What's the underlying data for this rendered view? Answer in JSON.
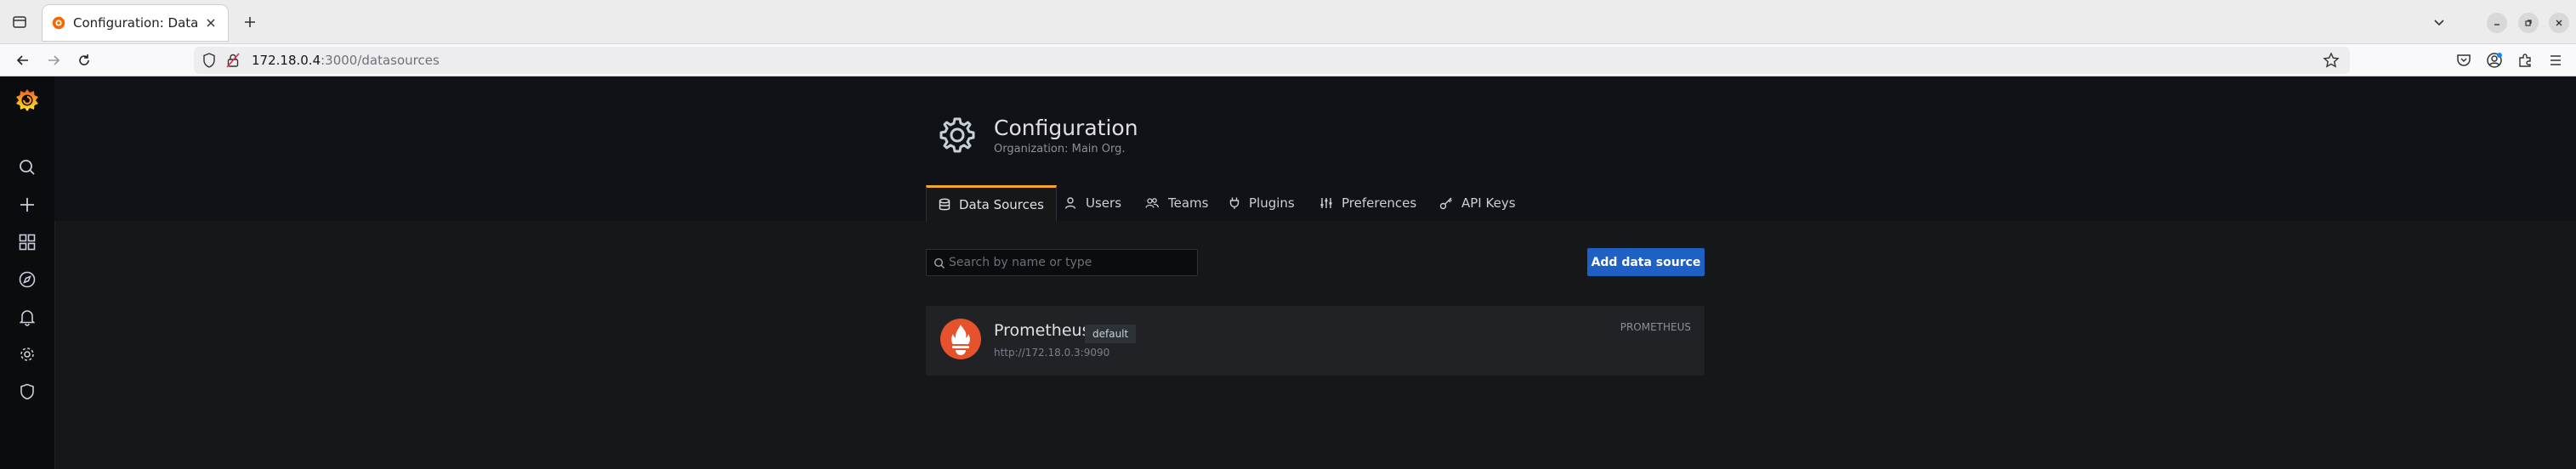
{
  "browser": {
    "tab_title": "Configuration: Data Sou",
    "url_host": "172.18.0.4",
    "url_path": ":3000/datasources"
  },
  "sidebar": {
    "items": [
      {
        "icon": "search-icon"
      },
      {
        "icon": "plus-icon"
      },
      {
        "icon": "dashboards-icon"
      },
      {
        "icon": "compass-icon"
      },
      {
        "icon": "bell-icon"
      },
      {
        "icon": "gear-icon"
      },
      {
        "icon": "shield-icon"
      }
    ]
  },
  "header": {
    "title": "Configuration",
    "subtitle": "Organization: Main Org."
  },
  "tabs": [
    {
      "label": "Data Sources",
      "icon": "database-icon",
      "active": true
    },
    {
      "label": "Users",
      "icon": "user-icon",
      "active": false
    },
    {
      "label": "Teams",
      "icon": "users-icon",
      "active": false
    },
    {
      "label": "Plugins",
      "icon": "plug-icon",
      "active": false
    },
    {
      "label": "Preferences",
      "icon": "sliders-icon",
      "active": false
    },
    {
      "label": "API Keys",
      "icon": "key-icon",
      "active": false
    }
  ],
  "search": {
    "placeholder": "Search by name or type",
    "value": ""
  },
  "actions": {
    "add_label": "Add data source"
  },
  "datasources": [
    {
      "name": "Prometheus",
      "badge": "default",
      "url": "http://172.18.0.3:9090",
      "type": "PROMETHEUS"
    }
  ],
  "colors": {
    "accent_tab": "#f5a623",
    "primary_button": "#1f60c4",
    "prometheus": "#e6522c"
  }
}
